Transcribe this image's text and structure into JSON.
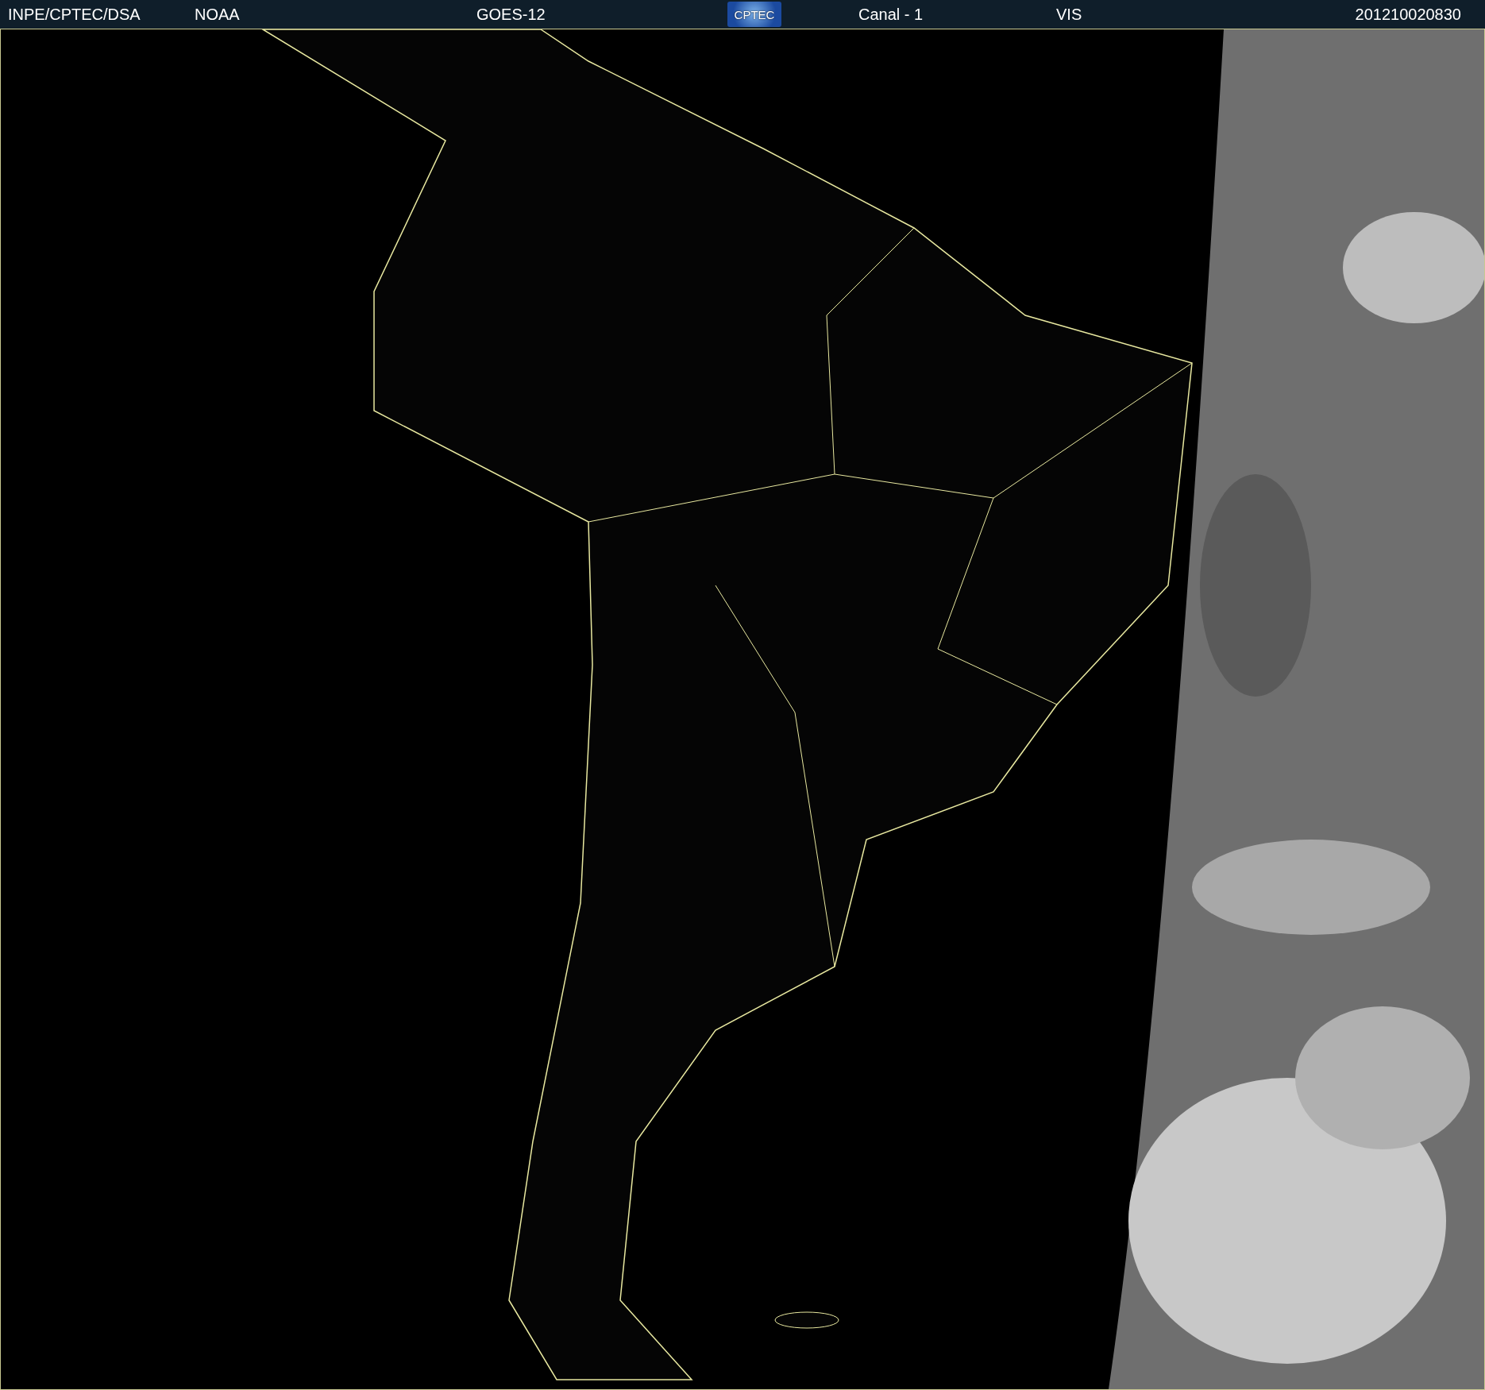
{
  "header": {
    "items": [
      {
        "kind": "text",
        "text": "INPE/CPTEC/DSA"
      },
      {
        "kind": "text",
        "text": "NOAA"
      },
      {
        "kind": "text",
        "text": "GOES-12"
      },
      {
        "kind": "logo",
        "text": "CPTEC"
      },
      {
        "kind": "text",
        "text": "Canal - 1"
      },
      {
        "kind": "text",
        "text": "VIS"
      },
      {
        "kind": "text",
        "text": "201210020830"
      }
    ]
  }
}
